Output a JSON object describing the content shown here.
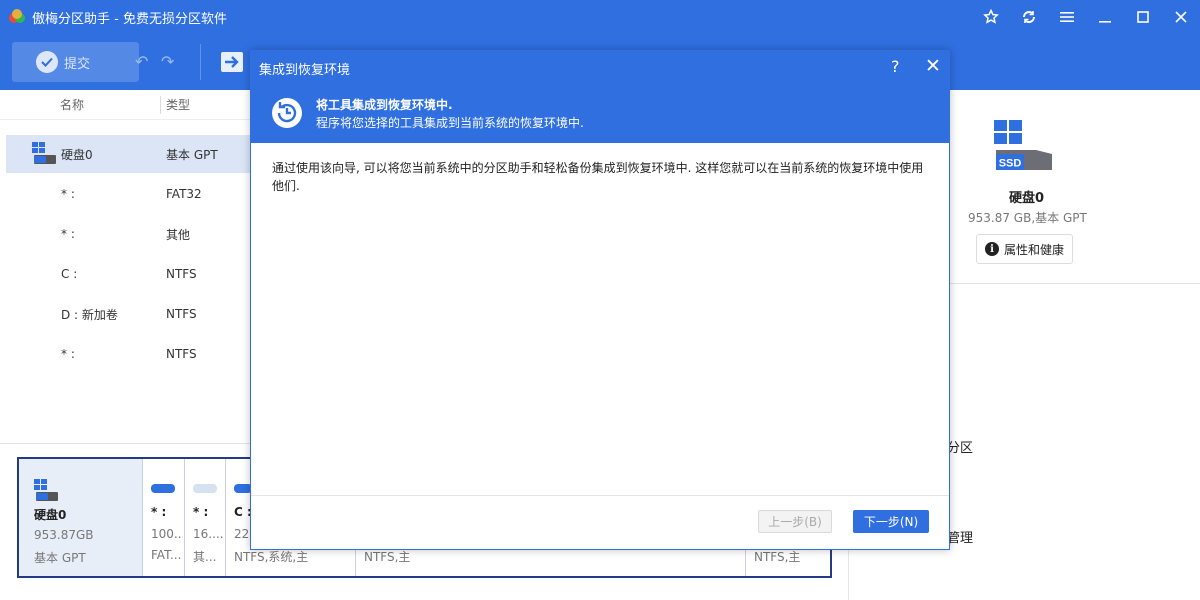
{
  "app": {
    "title": "傲梅分区助手 - 免费无损分区软件"
  },
  "toolbar": {
    "commit_label": "提交"
  },
  "list": {
    "headers": {
      "name": "名称",
      "type": "类型"
    },
    "rows": [
      {
        "name": "硬盘0",
        "type": "基本 GPT"
      },
      {
        "name": "* :",
        "type": "FAT32"
      },
      {
        "name": "* :",
        "type": "其他"
      },
      {
        "name": "C :",
        "type": "NTFS"
      },
      {
        "name": "D : 新加卷",
        "type": "NTFS"
      },
      {
        "name": "* :",
        "type": "NTFS"
      }
    ]
  },
  "disk_map": {
    "disk_name": "硬盘0",
    "disk_size": "953.87GB",
    "disk_type": "基本 GPT",
    "partitions": [
      {
        "label": "* :",
        "size": "100...",
        "fs": "FAT..."
      },
      {
        "label": "* :",
        "size": "16....",
        "fs": "其..."
      },
      {
        "label": "C :",
        "size": "22",
        "fs": "NTFS,系统,主"
      },
      {
        "label": "",
        "size": "",
        "fs": "NTFS,主"
      },
      {
        "label": "",
        "size": "",
        "fs": "NTFS,主"
      }
    ]
  },
  "right_panel": {
    "disk_name": "硬盘0",
    "disk_info": "953.87 GB,基本 GPT",
    "props_button": "属性和健康",
    "ssd_label": "SSD",
    "partial_text_1": "分区",
    "partial_text_2": "管理"
  },
  "modal": {
    "title": "集成到恢复环境",
    "help": "?",
    "close": "✕",
    "header_title": "将工具集成到恢复环境中.",
    "header_desc": "程序将您选择的工具集成到当前系统的恢复环境中.",
    "body_text": "通过使用该向导, 可以将您当前系统中的分区助手和轻松备份集成到恢复环境中. 这样您就可以在当前系统的恢复环境中使用他们.",
    "prev_button": "上一步(B)",
    "next_button": "下一步(N)"
  },
  "colors": {
    "primary": "#2f6fe0",
    "selected_row": "#dbe5f6",
    "disk_map_border": "#213b84"
  }
}
